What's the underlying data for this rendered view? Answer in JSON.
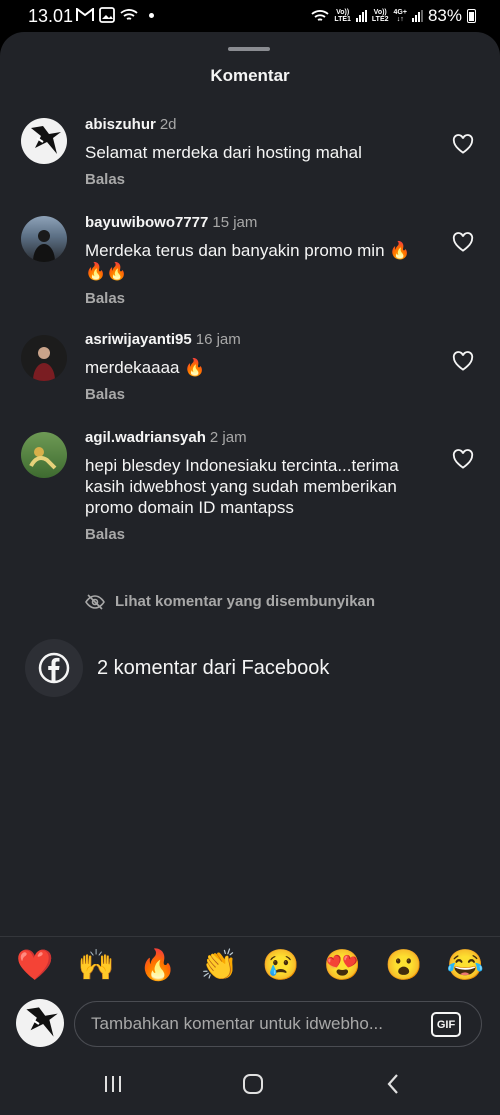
{
  "status_bar": {
    "time": "13.01",
    "network1": [
      "Vo))",
      "LTE1"
    ],
    "network2": [
      "Vo))",
      "LTE2"
    ],
    "network3": "4G+",
    "battery": "83%"
  },
  "sheet": {
    "title": "Komentar"
  },
  "comments": [
    {
      "username": "abiszuhur",
      "time": "2d",
      "text": "Selamat merdeka dari hosting mahal",
      "reply": "Balas"
    },
    {
      "username": "bayuwibowo7777",
      "time": "15 jam",
      "text": "Merdeka terus dan banyakin promo min 🔥🔥🔥",
      "reply": "Balas"
    },
    {
      "username": "asriwijayanti95",
      "time": "16 jam",
      "text": "merdekaaaa 🔥",
      "reply": "Balas"
    },
    {
      "username": "agil.wadriansyah",
      "time": "2 jam",
      "text": "hepi blesdey Indonesiaku tercinta...terima kasih idwebhost yang sudah memberikan promo domain ID mantapss",
      "reply": "Balas"
    }
  ],
  "hidden_comments_label": "Lihat komentar yang disembunyikan",
  "facebook_comments_label": "2 komentar dari Facebook",
  "quick_emojis": [
    "❤️",
    "🙌",
    "🔥",
    "👏",
    "😢",
    "😍",
    "😮",
    "😂"
  ],
  "input": {
    "placeholder": "Tambahkan komentar untuk idwebho...",
    "gif_label": "GIF"
  },
  "colors": {
    "sheet_bg": "#212328",
    "text": "#f5f5f5",
    "muted": "#a8a8a8"
  }
}
